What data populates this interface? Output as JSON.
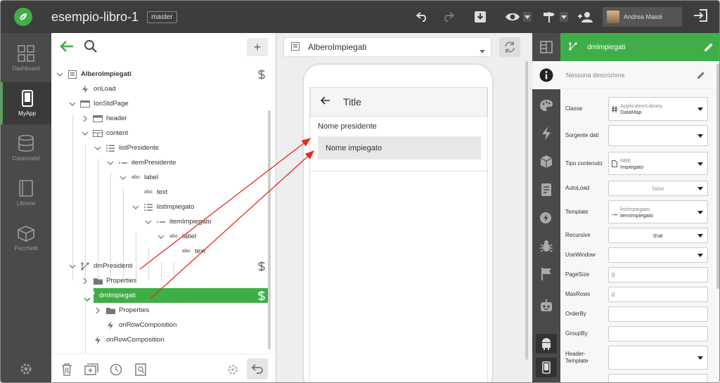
{
  "topbar": {
    "project_title": "esempio-libro-1",
    "branch": "master",
    "user_name": "Andrea Maioli"
  },
  "leftnav": {
    "items": [
      {
        "label": "Dashboard",
        "icon": "dashboard-icon",
        "active": false
      },
      {
        "label": "MyApp",
        "icon": "phone-icon",
        "active": true
      },
      {
        "label": "Datamodel",
        "icon": "database-icon",
        "active": false
      },
      {
        "label": "Librerie",
        "icon": "book-icon",
        "active": false
      },
      {
        "label": "Pacchetti",
        "icon": "box-icon",
        "active": false
      }
    ]
  },
  "tree": {
    "rows": [
      {
        "label": "AlberoImpiegati",
        "bold": true
      },
      {
        "label": "onLoad"
      },
      {
        "label": "IonStdPage"
      },
      {
        "label": "header"
      },
      {
        "label": "content"
      },
      {
        "label": "listPresidente"
      },
      {
        "label": "itemPresidente"
      },
      {
        "label": "label",
        "badge": "abc"
      },
      {
        "label": "text",
        "badge": "abc"
      },
      {
        "label": "listImpiegato"
      },
      {
        "label": "itemImpiegato"
      },
      {
        "label": "label",
        "badge": "abc"
      },
      {
        "label": "text",
        "badge": "abc"
      },
      {
        "label": "dmPresidenti"
      },
      {
        "label": "Properties"
      },
      {
        "label": "dmImpiegati",
        "selected": true
      },
      {
        "label": "Properties"
      },
      {
        "label": "onRowComposition"
      },
      {
        "label": "onRowComposition"
      }
    ]
  },
  "center": {
    "page_select": "AlberoImpiegati",
    "phone": {
      "title": "Title",
      "item_president": "Nome presidente",
      "item_employee": "Nome impiegato"
    }
  },
  "props": {
    "header_title": "dmImpiegati",
    "description": "Nessuna descrizione",
    "rows": {
      "classe": {
        "label": "Classe",
        "sub": "ApplicationLibrary.",
        "value": "DataMap"
      },
      "sorgente": {
        "label": "Sorgente dati",
        "value": ""
      },
      "tipo": {
        "label": "Tipo contenuto",
        "sub": "NBE.",
        "value": "Impiegato"
      },
      "autoload": {
        "label": "AutoLoad",
        "value": "false"
      },
      "template": {
        "label": "Template",
        "sub": "listImpiegato.",
        "value": "itemImpiegato"
      },
      "recursive": {
        "label": "Recursive",
        "value": "true"
      },
      "usewindow": {
        "label": "UseWindow",
        "value": ""
      },
      "pagesize": {
        "label": "PageSize",
        "value": "0"
      },
      "maxrows": {
        "label": "MaxRows",
        "value": "0"
      },
      "orderby": {
        "label": "OrderBy",
        "value": ""
      },
      "groupby": {
        "label": "GroupBy",
        "value": ""
      },
      "headertemplate": {
        "label": "Header-\nTemplate",
        "value": ""
      }
    }
  },
  "colors": {
    "accent": "#3fae49",
    "topbar": "#3d3d3d",
    "sidebar": "#4a4a4a",
    "arrow": "#e8291c"
  }
}
